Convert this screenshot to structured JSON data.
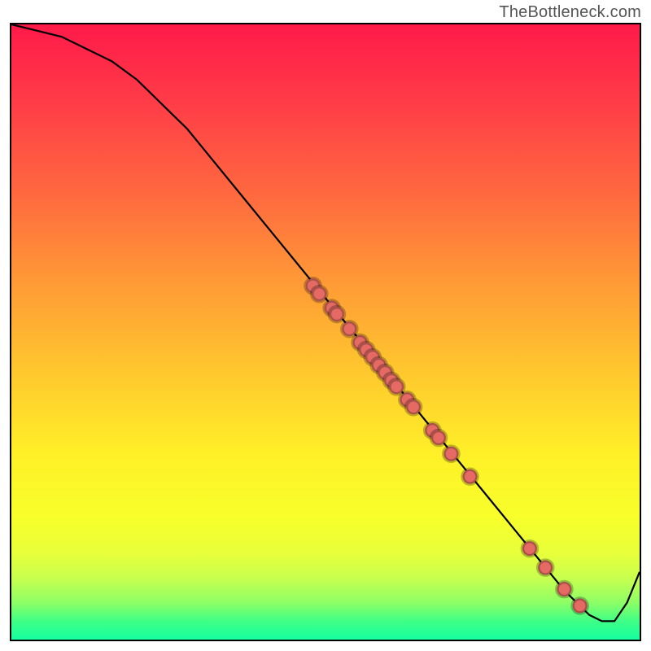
{
  "attribution": "TheBottleneck.com",
  "colors": {
    "curve": "#000000",
    "dot": "#e46a63",
    "gradient_top": "#ff1a49",
    "gradient_bottom": "#16ffa0"
  },
  "chart_data": {
    "type": "line",
    "title": "",
    "xlabel": "",
    "ylabel": "",
    "xlim": [
      0,
      100
    ],
    "ylim": [
      0,
      100
    ],
    "curve": {
      "x": [
        0,
        4,
        8,
        12,
        16,
        20,
        24,
        28,
        32,
        36,
        40,
        44,
        48,
        52,
        56,
        60,
        64,
        68,
        72,
        76,
        80,
        84,
        88,
        90,
        92,
        94,
        96,
        98,
        100
      ],
      "y": [
        100,
        99,
        98,
        96,
        94,
        91,
        87,
        83,
        78,
        73,
        68,
        63,
        58,
        53,
        48,
        43,
        38,
        33,
        28,
        23,
        18,
        13,
        8,
        6,
        4,
        3,
        3,
        6,
        11
      ]
    },
    "dots": [
      {
        "x": 48.0,
        "y": 57.5
      },
      {
        "x": 49.0,
        "y": 56.2
      },
      {
        "x": 51.0,
        "y": 53.9
      },
      {
        "x": 51.8,
        "y": 52.9
      },
      {
        "x": 53.8,
        "y": 50.5
      },
      {
        "x": 55.5,
        "y": 48.3
      },
      {
        "x": 56.5,
        "y": 47.1
      },
      {
        "x": 57.5,
        "y": 45.9
      },
      {
        "x": 58.5,
        "y": 44.6
      },
      {
        "x": 59.5,
        "y": 43.4
      },
      {
        "x": 60.5,
        "y": 42.1
      },
      {
        "x": 61.3,
        "y": 41.1
      },
      {
        "x": 63.0,
        "y": 39.0
      },
      {
        "x": 64.0,
        "y": 37.8
      },
      {
        "x": 67.0,
        "y": 34.0
      },
      {
        "x": 68.0,
        "y": 32.8
      },
      {
        "x": 70.0,
        "y": 30.2
      },
      {
        "x": 73.0,
        "y": 26.5
      },
      {
        "x": 82.5,
        "y": 14.8
      },
      {
        "x": 85.0,
        "y": 11.7
      },
      {
        "x": 88.0,
        "y": 8.2
      },
      {
        "x": 90.5,
        "y": 5.5
      }
    ]
  }
}
